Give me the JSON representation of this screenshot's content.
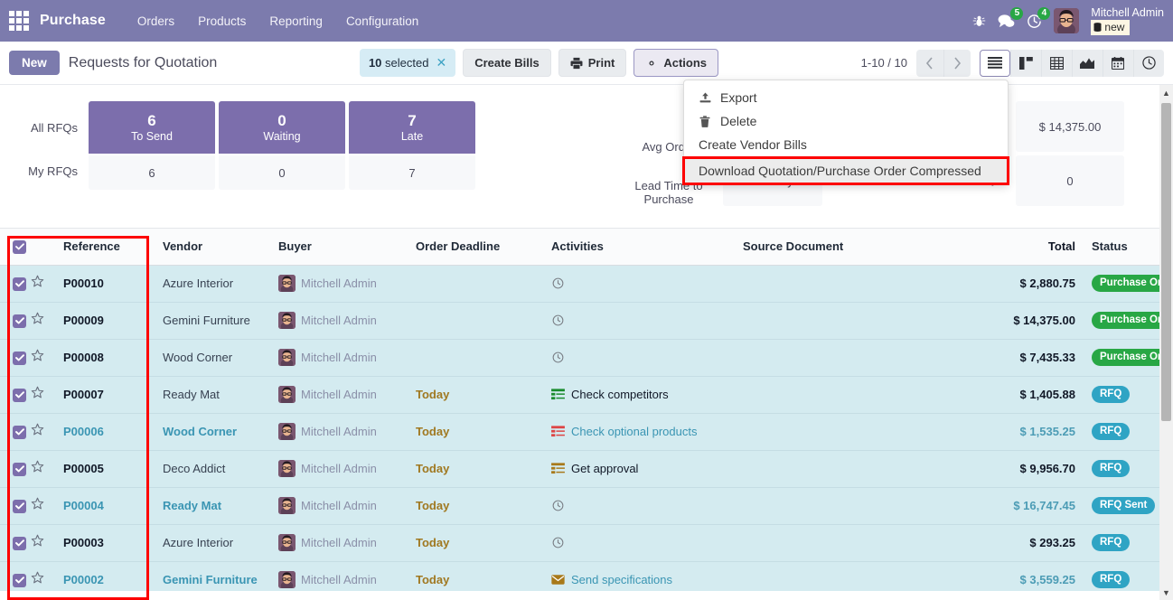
{
  "navbar": {
    "apps_icon": "apps-grid-icon",
    "brand": "Purchase",
    "menu": [
      {
        "label": "Orders"
      },
      {
        "label": "Products"
      },
      {
        "label": "Reporting"
      },
      {
        "label": "Configuration"
      }
    ],
    "bug_icon": "bug-icon",
    "messages": {
      "icon": "chat-icon",
      "count": "5",
      "color": "#28a745"
    },
    "activities": {
      "icon": "clock-icon",
      "count": "4",
      "color": "#28a745"
    },
    "user": {
      "name": "Mitchell Admin",
      "database": "new",
      "db_icon": "database-icon",
      "avatar": "avatar"
    }
  },
  "control_panel": {
    "new_label": "New",
    "breadcrumb": "Requests for Quotation",
    "selection": {
      "count": "10",
      "label": "selected",
      "close_icon": "close-icon"
    },
    "create_bills_label": "Create Bills",
    "print_label": "Print",
    "print_icon": "printer-icon",
    "actions_label": "Actions",
    "actions_icon": "gear-icon",
    "pager": "1-10 / 10",
    "prev_icon": "chevron-left-icon",
    "next_icon": "chevron-right-icon",
    "views": [
      {
        "name": "list",
        "icon": "list-icon",
        "active": true
      },
      {
        "name": "kanban",
        "icon": "kanban-icon",
        "active": false
      },
      {
        "name": "pivot",
        "icon": "pivot-table-icon",
        "active": false
      },
      {
        "name": "graph",
        "icon": "area-chart-icon",
        "active": false
      },
      {
        "name": "calendar",
        "icon": "calendar-icon",
        "active": false
      },
      {
        "name": "activity",
        "icon": "clock-icon",
        "active": false
      }
    ]
  },
  "actions_menu": {
    "items": [
      {
        "label": "Export",
        "icon": "upload-icon",
        "highlighted": false
      },
      {
        "label": "Delete",
        "icon": "trash-icon",
        "highlighted": false
      },
      {
        "label": "Create Vendor Bills",
        "icon": "",
        "highlighted": false
      },
      {
        "label": "Download Quotation/Purchase Order Compressed",
        "icon": "",
        "highlighted": true
      }
    ],
    "highlight_color": "#fd0000"
  },
  "kpi": {
    "row_labels": [
      "All RFQs",
      "My RFQs"
    ],
    "columns": [
      {
        "value": "6",
        "label": "To Send",
        "my_value": "6"
      },
      {
        "value": "0",
        "label": "Waiting",
        "my_value": "0"
      },
      {
        "value": "7",
        "label": "Late",
        "my_value": "7"
      }
    ],
    "right_labels": [
      {
        "line1": "Avg Order",
        "line2": ""
      },
      {
        "line1": "Lead Time to",
        "line2": "Purchase"
      }
    ],
    "middle_values": [
      "",
      "9.55 Days"
    ],
    "right_units": [
      "",
      "Days"
    ],
    "right_values": [
      "$ 14,375.00",
      "0"
    ]
  },
  "table": {
    "headers": {
      "reference": "Reference",
      "vendor": "Vendor",
      "buyer": "Buyer",
      "order_deadline": "Order Deadline",
      "activities": "Activities",
      "source_document": "Source Document",
      "total": "Total",
      "status": "Status",
      "options_icon": "settings-sliders-icon"
    },
    "select_all_checked": true,
    "rows": [
      {
        "checked": true,
        "star": "star-outline-icon",
        "reference": "P00010",
        "ref_link": false,
        "vendor": "Azure Interior",
        "vendor_link": false,
        "buyer": "Mitchell Admin",
        "order_deadline": "",
        "activity_icon": "clock-icon",
        "activity_text": "",
        "activity_link": false,
        "source_document": "",
        "total": "$ 2,880.75",
        "total_muted": false,
        "status": "Purchase Order",
        "status_type": "po"
      },
      {
        "checked": true,
        "star": "star-outline-icon",
        "reference": "P00009",
        "ref_link": false,
        "vendor": "Gemini Furniture",
        "vendor_link": false,
        "buyer": "Mitchell Admin",
        "order_deadline": "",
        "activity_icon": "clock-icon",
        "activity_text": "",
        "activity_link": false,
        "source_document": "",
        "total": "$ 14,375.00",
        "total_muted": false,
        "status": "Purchase Order",
        "status_type": "po"
      },
      {
        "checked": true,
        "star": "star-outline-icon",
        "reference": "P00008",
        "ref_link": false,
        "vendor": "Wood Corner",
        "vendor_link": false,
        "buyer": "Mitchell Admin",
        "order_deadline": "",
        "activity_icon": "clock-icon",
        "activity_text": "",
        "activity_link": false,
        "source_document": "",
        "total": "$ 7,435.33",
        "total_muted": false,
        "status": "Purchase Order",
        "status_type": "po"
      },
      {
        "checked": true,
        "star": "star-outline-icon",
        "reference": "P00007",
        "ref_link": false,
        "vendor": "Ready Mat",
        "vendor_link": false,
        "buyer": "Mitchell Admin",
        "order_deadline": "Today",
        "activity_icon": "tasks-green-icon",
        "activity_text": "Check competitors",
        "activity_link": false,
        "source_document": "",
        "total": "$ 1,405.88",
        "total_muted": false,
        "status": "RFQ",
        "status_type": "rfq"
      },
      {
        "checked": true,
        "star": "star-outline-icon",
        "reference": "P00006",
        "ref_link": true,
        "vendor": "Wood Corner",
        "vendor_link": true,
        "buyer": "Mitchell Admin",
        "order_deadline": "Today",
        "activity_icon": "tasks-red-icon",
        "activity_text": "Check optional products",
        "activity_link": true,
        "source_document": "",
        "total": "$ 1,535.25",
        "total_muted": true,
        "status": "RFQ",
        "status_type": "rfq"
      },
      {
        "checked": true,
        "star": "star-outline-icon",
        "reference": "P00005",
        "ref_link": false,
        "vendor": "Deco Addict",
        "vendor_link": false,
        "buyer": "Mitchell Admin",
        "order_deadline": "Today",
        "activity_icon": "tasks-amber-icon",
        "activity_text": "Get approval",
        "activity_link": false,
        "source_document": "",
        "total": "$ 9,956.70",
        "total_muted": false,
        "status": "RFQ",
        "status_type": "rfq"
      },
      {
        "checked": true,
        "star": "star-outline-icon",
        "reference": "P00004",
        "ref_link": true,
        "vendor": "Ready Mat",
        "vendor_link": true,
        "buyer": "Mitchell Admin",
        "order_deadline": "Today",
        "activity_icon": "clock-icon",
        "activity_text": "",
        "activity_link": false,
        "source_document": "",
        "total": "$ 16,747.45",
        "total_muted": true,
        "status": "RFQ Sent",
        "status_type": "rfq"
      },
      {
        "checked": true,
        "star": "star-outline-icon",
        "reference": "P00003",
        "ref_link": false,
        "vendor": "Azure Interior",
        "vendor_link": false,
        "buyer": "Mitchell Admin",
        "order_deadline": "Today",
        "activity_icon": "clock-icon",
        "activity_text": "",
        "activity_link": false,
        "source_document": "",
        "total": "$ 293.25",
        "total_muted": false,
        "status": "RFQ",
        "status_type": "rfq"
      },
      {
        "checked": true,
        "star": "star-outline-icon",
        "reference": "P00002",
        "ref_link": true,
        "vendor": "Gemini Furniture",
        "vendor_link": true,
        "buyer": "Mitchell Admin",
        "order_deadline": "Today",
        "activity_icon": "envelope-amber-icon",
        "activity_text": "Send specifications",
        "activity_link": true,
        "source_document": "",
        "total": "$ 3,559.25",
        "total_muted": true,
        "status": "RFQ",
        "status_type": "rfq"
      }
    ]
  },
  "colors": {
    "brand_purple": "#7c7bad",
    "kpi_purple": "#7c6eac",
    "selected_row": "#d4ebf0",
    "badge_green": "#28a745",
    "badge_teal": "#2fa4c4",
    "link_teal": "#3a95b3",
    "deadline_amber": "#a07820",
    "highlight_red": "#fd0000"
  }
}
